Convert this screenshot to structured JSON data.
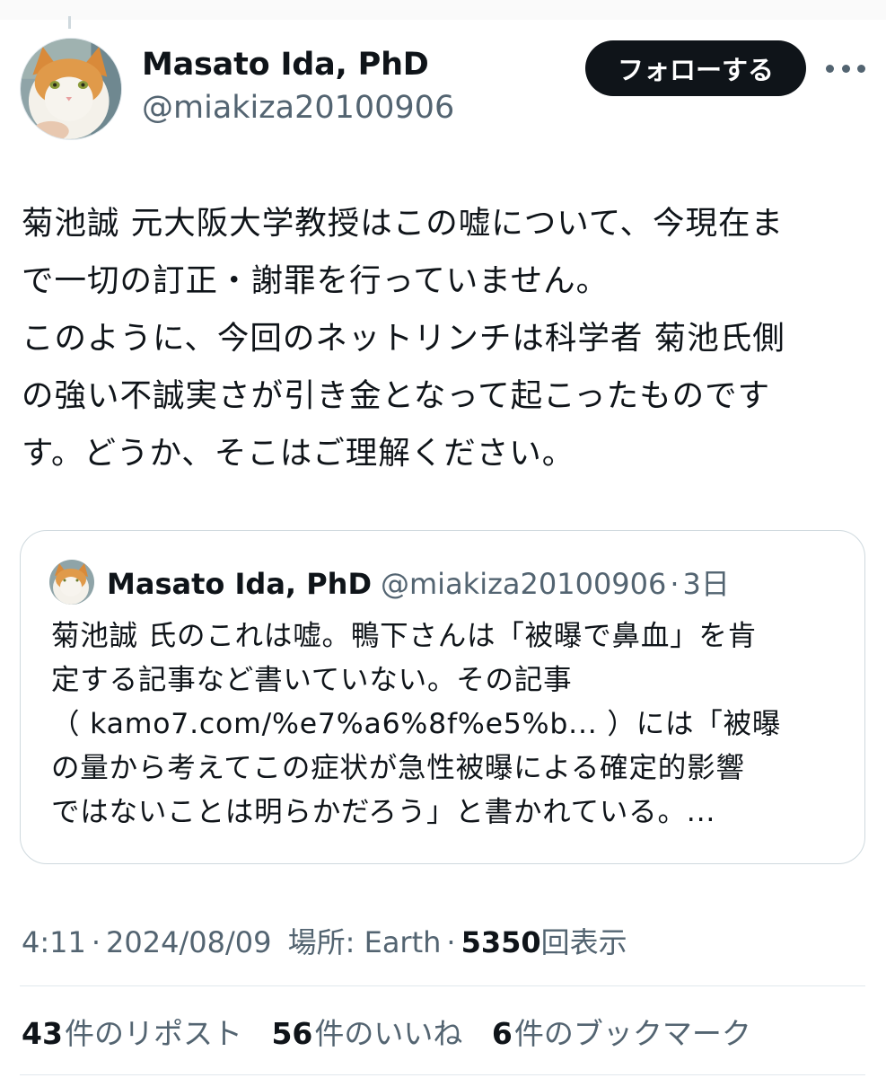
{
  "author": {
    "name": "Masato Ida, PhD",
    "handle": "@miakiza20100906",
    "follow_label": "フォローする"
  },
  "tweet": {
    "lines": [
      "菊池誠 元大阪大学教授はこの嘘について、今現在ま",
      "で一切の訂正・謝罪を行っていません。",
      "このように、今回のネットリンチは科学者 菊池氏側",
      "の強い不誠実さが引き金となって起こったものです",
      "す。どうか、そこはご理解ください。"
    ]
  },
  "quote": {
    "name": "Masato Ida, PhD",
    "handle": "@miakiza20100906",
    "separator": "·",
    "time": "3日",
    "lines": [
      "菊池誠 氏のこれは嘘。鴨下さんは「被曝で鼻血」を肯",
      "定する記事など書いていない。その記事",
      "（ kamo7.com/%e7%a6%8f%e5%b... ）には「被曝",
      "の量から考えてこの症状が急性被曝による確定的影響",
      "ではないことは明らかだろう」と書かれている。..."
    ]
  },
  "meta": {
    "time": "4:11",
    "sep": "·",
    "date": "2024/08/09",
    "location": "場所: Earth",
    "views_count": "5350",
    "views_label": "回表示"
  },
  "stats": {
    "reposts_count": "43",
    "reposts_label": "件のリポスト",
    "likes_count": "56",
    "likes_label": "件のいいね",
    "bookmarks_count": "6",
    "bookmarks_label": "件のブックマーク"
  },
  "colors": {
    "text": "#0f1419",
    "secondary": "#536471",
    "border": "#cfd9de",
    "follow_bg": "#0f1419"
  }
}
